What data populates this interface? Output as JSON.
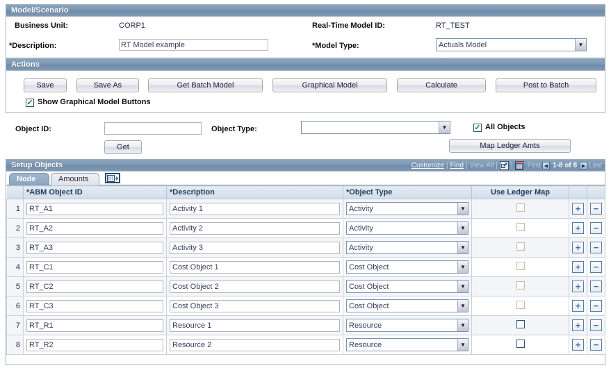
{
  "model_scenario": {
    "title": "Model/Scenario",
    "business_unit_label": "Business Unit:",
    "business_unit_value": "CORP1",
    "description_label": "*Description:",
    "description_value": "RT Model example",
    "real_time_model_id_label": "Real-Time Model ID:",
    "real_time_model_id_value": "RT_TEST",
    "model_type_label": "*Model Type:",
    "model_type_value": "Actuals Model"
  },
  "actions": {
    "title": "Actions",
    "buttons": [
      {
        "label": "Save",
        "name": "save-button"
      },
      {
        "label": "Save As",
        "name": "save-as-button"
      },
      {
        "label": "Get Batch Model",
        "name": "get-batch-model-button"
      },
      {
        "label": "Graphical Model",
        "name": "graphical-model-button"
      },
      {
        "label": "Calculate",
        "name": "calculate-button"
      },
      {
        "label": "Post to Batch",
        "name": "post-to-batch-button"
      }
    ],
    "show_graphical_label": "Show Graphical Model Buttons",
    "show_graphical_checked": true,
    "check_glyph": "✓"
  },
  "filter": {
    "object_id_label": "Object ID:",
    "object_id_value": "",
    "object_id_placeholder": "",
    "object_type_label": "Object Type:",
    "object_type_value": "",
    "get_button_label": "Get",
    "all_objects_label": "All Objects",
    "all_objects_checked": true,
    "map_ledger_amts_label": "Map Ledger Amts"
  },
  "setup_objects": {
    "title": "Setup Objects",
    "nav": {
      "customize": "Customize",
      "find": "Find",
      "view_all": "View All",
      "expand_icon": "expand-icon",
      "download_icon": "download-spreadsheet-icon",
      "first": "First",
      "prev_icon": "previous-page-icon",
      "count": "1-8 of 8",
      "next_icon": "next-page-icon",
      "last": "Last",
      "separator": "|"
    },
    "tabs": [
      {
        "label": "Node",
        "active": true
      },
      {
        "label": "Amounts",
        "active": false
      }
    ],
    "grid_icon_name": "show-all-columns-icon",
    "columns": [
      {
        "label": "",
        "name": "row-number-column"
      },
      {
        "label": "*ABM Object ID",
        "name": "abm-object-id-column"
      },
      {
        "label": "*Description",
        "name": "description-column"
      },
      {
        "label": "*Object Type",
        "name": "object-type-column"
      },
      {
        "label": "Use Ledger Map",
        "name": "use-ledger-map-column"
      },
      {
        "label": "",
        "name": "add-row-column"
      },
      {
        "label": "",
        "name": "delete-row-column"
      }
    ],
    "add_glyph": "+",
    "remove_glyph": "−",
    "rows": [
      {
        "num": "1",
        "abm_object_id": "RT_A1",
        "description": "Activity 1",
        "object_type": "Activity",
        "use_ledger_map": false,
        "ledger_map_enabled": false
      },
      {
        "num": "2",
        "abm_object_id": "RT_A2",
        "description": "Activity 2",
        "object_type": "Activity",
        "use_ledger_map": false,
        "ledger_map_enabled": false
      },
      {
        "num": "3",
        "abm_object_id": "RT_A3",
        "description": "Activity 3",
        "object_type": "Activity",
        "use_ledger_map": false,
        "ledger_map_enabled": false
      },
      {
        "num": "4",
        "abm_object_id": "RT_C1",
        "description": "Cost Object 1",
        "object_type": "Cost Object",
        "use_ledger_map": false,
        "ledger_map_enabled": false
      },
      {
        "num": "5",
        "abm_object_id": "RT_C2",
        "description": "Cost Object 2",
        "object_type": "Cost Object",
        "use_ledger_map": false,
        "ledger_map_enabled": false
      },
      {
        "num": "6",
        "abm_object_id": "RT_C3",
        "description": "Cost Object 3",
        "object_type": "Cost Object",
        "use_ledger_map": false,
        "ledger_map_enabled": false
      },
      {
        "num": "7",
        "abm_object_id": "RT_R1",
        "description": "Resource 1",
        "object_type": "Resource",
        "use_ledger_map": false,
        "ledger_map_enabled": true
      },
      {
        "num": "8",
        "abm_object_id": "RT_R2",
        "description": "Resource 2",
        "object_type": "Resource",
        "use_ledger_map": false,
        "ledger_map_enabled": true
      }
    ]
  },
  "colors": {
    "header_bar": "#7e99b4",
    "header_text": "#ffffff",
    "grid_header": "#d3deea",
    "accent_link": "#ffffff",
    "checkbox_border": "#2d5480",
    "check_green": "#14892c",
    "plus_blue": "#3b6ea5"
  }
}
